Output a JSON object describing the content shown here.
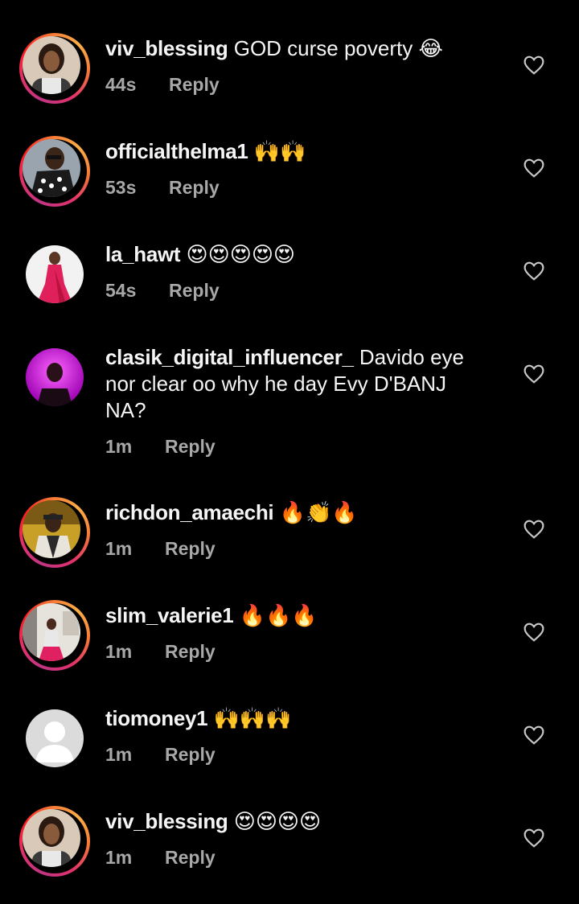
{
  "comments": [
    {
      "username": "viv_blessing",
      "text": "GOD curse poverty",
      "emoji": "😂",
      "time": "44s",
      "reply": "Reply",
      "avatar": "photo-woman-1",
      "story_ring": true
    },
    {
      "username": "officialthelma1",
      "text": "",
      "emoji": "🙌🙌",
      "time": "53s",
      "reply": "Reply",
      "avatar": "photo-woman-2",
      "story_ring": true
    },
    {
      "username": "la_hawt",
      "text": "",
      "emoji": "😍😍😍😍😍",
      "time": "54s",
      "reply": "Reply",
      "avatar": "photo-woman-pink",
      "story_ring": false
    },
    {
      "username": "clasik_digital_influencer_",
      "text": "Davido eye nor clear oo why he day Evy D'BANJ NA?",
      "emoji": "",
      "time": "1m",
      "reply": "Reply",
      "avatar": "photo-man-purple",
      "story_ring": false
    },
    {
      "username": "richdon_amaechi",
      "text": "",
      "emoji": "🔥👏🔥",
      "time": "1m",
      "reply": "Reply",
      "avatar": "photo-man-car",
      "story_ring": true
    },
    {
      "username": "slim_valerie1",
      "text": "",
      "emoji": "🔥🔥🔥",
      "time": "1m",
      "reply": "Reply",
      "avatar": "photo-woman-room",
      "story_ring": true
    },
    {
      "username": "tiomoney1",
      "text": "",
      "emoji": "🙌🙌🙌",
      "time": "1m",
      "reply": "Reply",
      "avatar": "default-avatar",
      "story_ring": false
    },
    {
      "username": "viv_blessing",
      "text": "",
      "emoji": "😍😍😍😍",
      "time": "1m",
      "reply": "Reply",
      "avatar": "photo-woman-1",
      "story_ring": true
    }
  ],
  "colors": {
    "background": "#000000",
    "text": "#f5f5f5",
    "meta": "#a8a8a8",
    "story_ring_start": "#c13584",
    "story_ring_end": "#fcaf45"
  },
  "icons": {
    "like": "heart-outline-icon"
  }
}
